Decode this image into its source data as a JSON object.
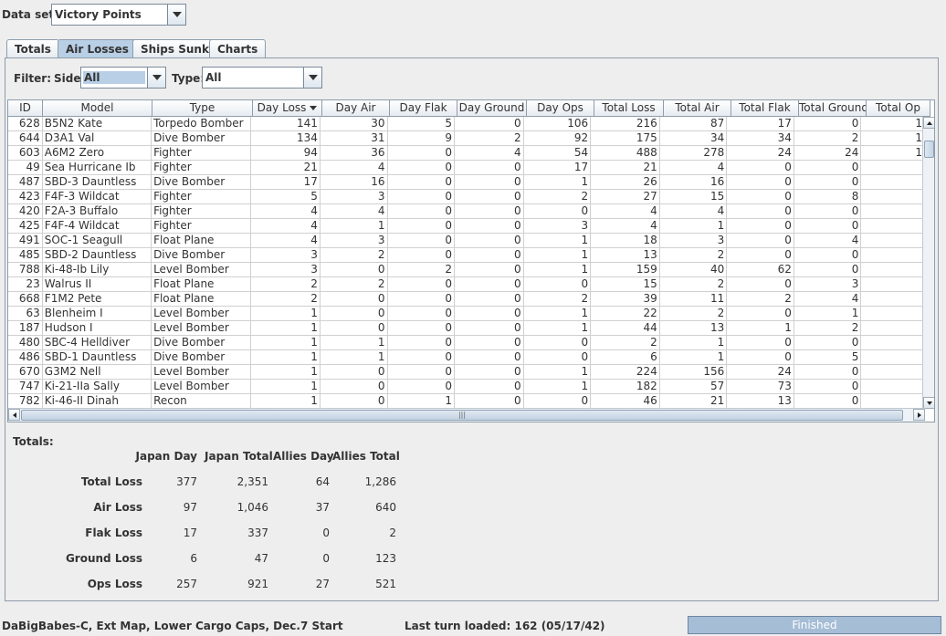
{
  "dataset": {
    "label": "Data set:",
    "value": "Victory Points"
  },
  "tabs": [
    "Totals",
    "Air Losses",
    "Ships Sunk",
    "Charts"
  ],
  "active_tab": 1,
  "filter": {
    "label": "Filter:",
    "side_label": "Side:",
    "side_value": "All",
    "type_label": "Type:",
    "type_value": "All"
  },
  "table": {
    "columns": [
      "ID",
      "Model",
      "Type",
      "Day Loss",
      "Day Air",
      "Day Flak",
      "Day Ground",
      "Day Ops",
      "Total Loss",
      "Total Air",
      "Total Flak",
      "Total Ground",
      "Total Op"
    ],
    "sorted_column": 3,
    "rows": [
      [
        "628",
        "B5N2 Kate",
        "Torpedo Bomber",
        "141",
        "30",
        "5",
        "0",
        "106",
        "216",
        "87",
        "17",
        "0",
        "1"
      ],
      [
        "644",
        "D3A1 Val",
        "Dive Bomber",
        "134",
        "31",
        "9",
        "2",
        "92",
        "175",
        "34",
        "34",
        "2",
        "1"
      ],
      [
        "603",
        "A6M2 Zero",
        "Fighter",
        "94",
        "36",
        "0",
        "4",
        "54",
        "488",
        "278",
        "24",
        "24",
        "1"
      ],
      [
        "49",
        "Sea Hurricane Ib",
        "Fighter",
        "21",
        "4",
        "0",
        "0",
        "17",
        "21",
        "4",
        "0",
        "0",
        ""
      ],
      [
        "487",
        "SBD-3 Dauntless",
        "Dive Bomber",
        "17",
        "16",
        "0",
        "0",
        "1",
        "26",
        "16",
        "0",
        "0",
        ""
      ],
      [
        "423",
        "F4F-3 Wildcat",
        "Fighter",
        "5",
        "3",
        "0",
        "0",
        "2",
        "27",
        "15",
        "0",
        "8",
        ""
      ],
      [
        "420",
        "F2A-3 Buffalo",
        "Fighter",
        "4",
        "4",
        "0",
        "0",
        "0",
        "4",
        "4",
        "0",
        "0",
        ""
      ],
      [
        "425",
        "F4F-4 Wildcat",
        "Fighter",
        "4",
        "1",
        "0",
        "0",
        "3",
        "4",
        "1",
        "0",
        "0",
        ""
      ],
      [
        "491",
        "SOC-1 Seagull",
        "Float Plane",
        "4",
        "3",
        "0",
        "0",
        "1",
        "18",
        "3",
        "0",
        "4",
        ""
      ],
      [
        "485",
        "SBD-2 Dauntless",
        "Dive Bomber",
        "3",
        "2",
        "0",
        "0",
        "1",
        "13",
        "2",
        "0",
        "0",
        ""
      ],
      [
        "788",
        "Ki-48-Ib Lily",
        "Level Bomber",
        "3",
        "0",
        "2",
        "0",
        "1",
        "159",
        "40",
        "62",
        "0",
        ""
      ],
      [
        "23",
        "Walrus II",
        "Float Plane",
        "2",
        "2",
        "0",
        "0",
        "0",
        "15",
        "2",
        "0",
        "3",
        ""
      ],
      [
        "668",
        "F1M2 Pete",
        "Float Plane",
        "2",
        "0",
        "0",
        "0",
        "2",
        "39",
        "11",
        "2",
        "4",
        ""
      ],
      [
        "63",
        "Blenheim I",
        "Level Bomber",
        "1",
        "0",
        "0",
        "0",
        "1",
        "22",
        "2",
        "0",
        "1",
        ""
      ],
      [
        "187",
        "Hudson I",
        "Level Bomber",
        "1",
        "0",
        "0",
        "0",
        "1",
        "44",
        "13",
        "1",
        "2",
        ""
      ],
      [
        "480",
        "SBC-4 Helldiver",
        "Dive Bomber",
        "1",
        "1",
        "0",
        "0",
        "0",
        "2",
        "1",
        "0",
        "0",
        ""
      ],
      [
        "486",
        "SBD-1 Dauntless",
        "Dive Bomber",
        "1",
        "1",
        "0",
        "0",
        "0",
        "6",
        "1",
        "0",
        "5",
        ""
      ],
      [
        "670",
        "G3M2 Nell",
        "Level Bomber",
        "1",
        "0",
        "0",
        "0",
        "1",
        "224",
        "156",
        "24",
        "0",
        ""
      ],
      [
        "747",
        "Ki-21-IIa Sally",
        "Level Bomber",
        "1",
        "0",
        "0",
        "0",
        "1",
        "182",
        "57",
        "73",
        "0",
        ""
      ],
      [
        "782",
        "Ki-46-II Dinah",
        "Recon",
        "1",
        "0",
        "1",
        "0",
        "0",
        "46",
        "21",
        "13",
        "0",
        ""
      ]
    ]
  },
  "totals": {
    "title": "Totals:",
    "headers": [
      "Japan Day",
      "Japan Total",
      "Allies Day",
      "Allies Total"
    ],
    "rows": [
      {
        "label": "Total Loss",
        "values": [
          "377",
          "2,351",
          "64",
          "1,286"
        ]
      },
      {
        "label": "Air Loss",
        "values": [
          "97",
          "1,046",
          "37",
          "640"
        ]
      },
      {
        "label": "Flak Loss",
        "values": [
          "17",
          "337",
          "0",
          "2"
        ]
      },
      {
        "label": "Ground Loss",
        "values": [
          "6",
          "47",
          "0",
          "123"
        ]
      },
      {
        "label": "Ops Loss",
        "values": [
          "257",
          "921",
          "27",
          "521"
        ]
      }
    ]
  },
  "status": {
    "scenario": "DaBigBabes-C, Ext Map, Lower Cargo Caps, Dec.7 Start",
    "last_turn": "Last turn loaded: 162 (05/17/42)",
    "progress_text": "Finished"
  },
  "colors": {
    "selection": "#b8cfe5",
    "progress": "#a6bdd6",
    "border": "#8e9cab"
  },
  "icons": {
    "combo_arrow": "chevron-down-icon",
    "sort": "sort-descending-icon"
  }
}
